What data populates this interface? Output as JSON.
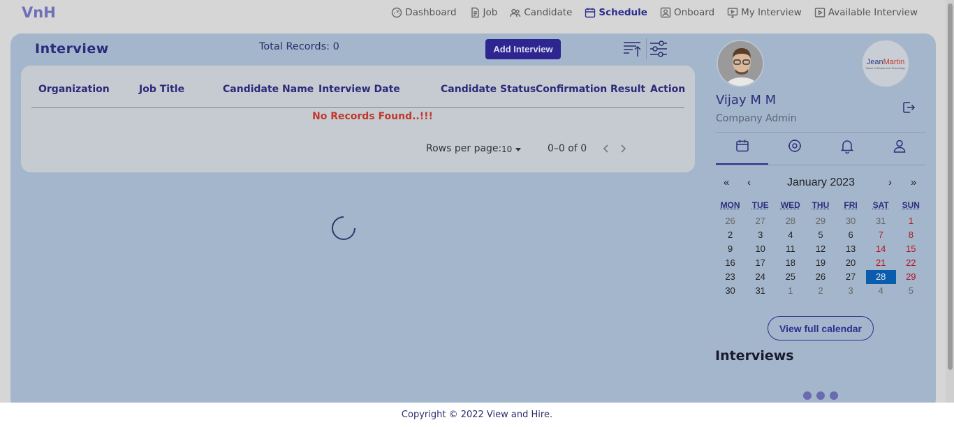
{
  "brand": "VnH",
  "nav": {
    "dashboard": "Dashboard",
    "job": "Job",
    "candidate": "Candidate",
    "schedule": "Schedule",
    "onboard": "Onboard",
    "my_interview": "My Interview",
    "available_interview": "Available Interview"
  },
  "page": {
    "title": "Interview",
    "total_records": "Total Records: 0",
    "add_button": "Add Interview"
  },
  "table": {
    "columns": [
      "Organization",
      "Job Title",
      "Candidate Name",
      "Interview Date",
      "Candidate Status",
      "Confirmation",
      "Result",
      "Action"
    ],
    "empty_message": "No Records Found..!!!",
    "rows_per_page_label": "Rows per page:",
    "rows_per_page_value": "10",
    "range": "0–0 of 0"
  },
  "profile": {
    "name": "Vijay M M",
    "role": "Company Admin",
    "company_logo_text_a": "Jean",
    "company_logo_text_b": "Martin",
    "company_logo_tagline": "Power of People and Technology"
  },
  "calendar": {
    "title": "January 2023",
    "prev_year": "«",
    "prev_month": "‹",
    "next_month": "›",
    "next_year": "»",
    "weekdays": [
      "MON",
      "TUE",
      "WED",
      "THU",
      "FRI",
      "SAT",
      "SUN"
    ],
    "weeks": [
      [
        "26",
        "27",
        "28",
        "29",
        "30",
        "31",
        "1"
      ],
      [
        "2",
        "3",
        "4",
        "5",
        "6",
        "7",
        "8"
      ],
      [
        "9",
        "10",
        "11",
        "12",
        "13",
        "14",
        "15"
      ],
      [
        "16",
        "17",
        "18",
        "19",
        "20",
        "21",
        "22"
      ],
      [
        "23",
        "24",
        "25",
        "26",
        "27",
        "28",
        "29"
      ],
      [
        "30",
        "31",
        "1",
        "2",
        "3",
        "4",
        "5"
      ]
    ],
    "selected_day": "28",
    "view_full_button": "View full calendar"
  },
  "sidebar_heading": "Interviews",
  "footer": "Copyright © 2022 View and Hire."
}
